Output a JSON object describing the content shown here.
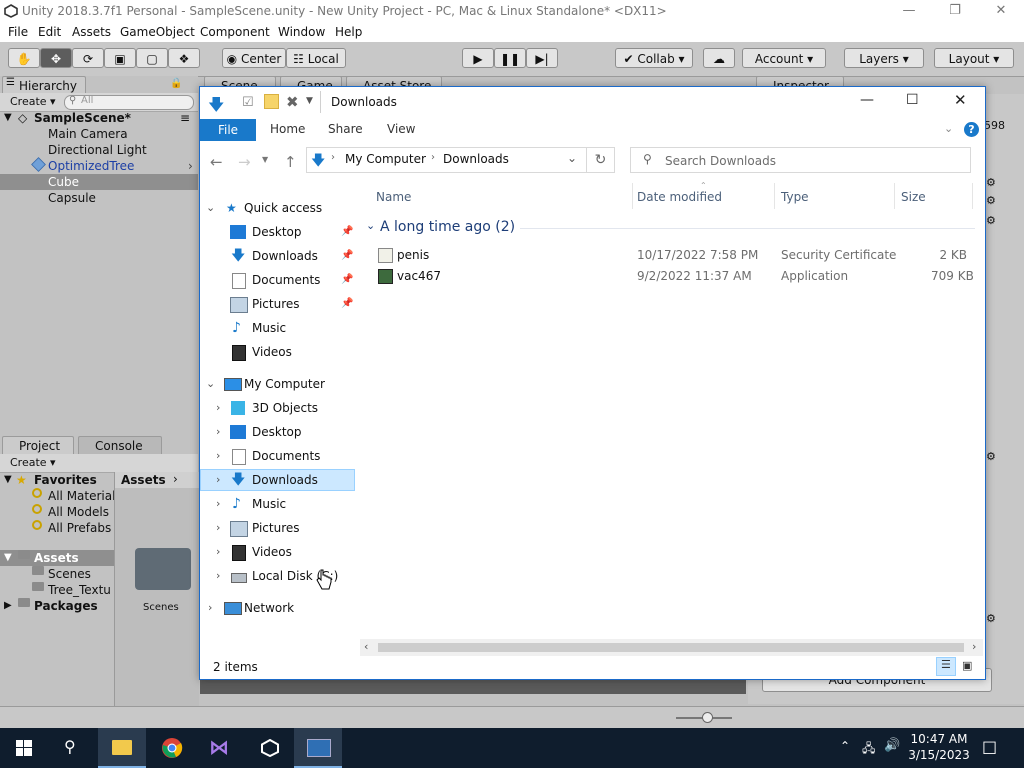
{
  "unity": {
    "title": "Unity 2018.3.7f1 Personal - SampleScene.unity - New Unity Project - PC, Mac & Linux Standalone* <DX11>",
    "menu": [
      "File",
      "Edit",
      "Assets",
      "GameObject",
      "Component",
      "Window",
      "Help"
    ],
    "toolbar": {
      "pivot": "Center",
      "space": "Local",
      "collab": "Collab",
      "account": "Account",
      "layers": "Layers",
      "layout": "Layout"
    },
    "hierarchy": {
      "tab": "Hierarchy",
      "create": "Create",
      "search_placeholder": "All",
      "scene": "SampleScene*",
      "items": [
        "Main Camera",
        "Directional Light",
        "OptimizedTree",
        "Cube",
        "Capsule"
      ]
    },
    "tabs": {
      "scene": "Scene",
      "game": "Game",
      "asset_store": "Asset Store",
      "inspector": "Inspector"
    },
    "project": {
      "tab": "Project",
      "console_tab": "Console",
      "create": "Create",
      "favorites": "Favorites",
      "favorites_items": [
        "All Materials",
        "All Models",
        "All Prefabs"
      ],
      "assets": "Assets",
      "assets_items": [
        "Scenes",
        "Tree_Textu"
      ],
      "packages": "Packages",
      "breadcrumb": "Assets",
      "folder_label": "Scenes"
    },
    "inspector": {
      "add_component": "Add Component",
      "fragment": "598"
    }
  },
  "explorer": {
    "title": "Downloads",
    "ribbon": {
      "file": "File",
      "home": "Home",
      "share": "Share",
      "view": "View"
    },
    "address": [
      "My Computer",
      "Downloads"
    ],
    "search_placeholder": "Search Downloads",
    "nav": {
      "quick_access": "Quick access",
      "quick_items": [
        "Desktop",
        "Downloads",
        "Documents",
        "Pictures",
        "Music",
        "Videos"
      ],
      "my_computer": "My Computer",
      "computer_items": [
        "3D Objects",
        "Desktop",
        "Documents",
        "Downloads",
        "Music",
        "Pictures",
        "Videos",
        "Local Disk (C:)"
      ],
      "network": "Network"
    },
    "columns": {
      "name": "Name",
      "date": "Date modified",
      "type": "Type",
      "size": "Size"
    },
    "group": "A long time ago (2)",
    "files": [
      {
        "name": "penis",
        "date": "10/17/2022 7:58 PM",
        "type": "Security Certificate",
        "size": "2 KB"
      },
      {
        "name": "vac467",
        "date": "9/2/2022 11:37 AM",
        "type": "Application",
        "size": "709 KB"
      }
    ],
    "status": "2 items"
  },
  "taskbar": {
    "time": "10:47 AM",
    "date": "3/15/2023"
  },
  "colors": {
    "accent": "#1979ca",
    "selection": "#cce8ff",
    "taskbar": "#0f1d2d",
    "unity_panel": "#c2c2c2"
  }
}
